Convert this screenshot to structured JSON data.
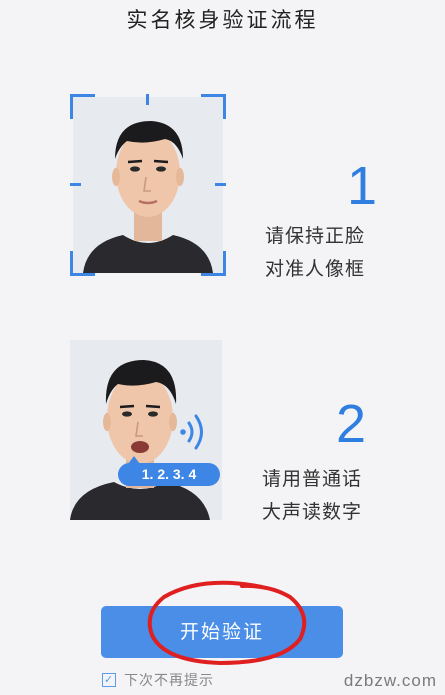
{
  "header": {
    "title": "实名核身验证流程"
  },
  "steps": [
    {
      "number": "1",
      "line1": "请保持正脸",
      "line2": "对准人像框"
    },
    {
      "number": "2",
      "line1": "请用普通话",
      "line2": "大声读数字",
      "digits": "1. 2. 3. 4"
    }
  ],
  "actions": {
    "start_label": "开始验证",
    "dont_show_label": "下次不再提示",
    "dont_show_checked": true
  },
  "watermark": "dzbzw.com",
  "colors": {
    "accent": "#3d86e6",
    "button": "#4a8ee8",
    "annotation": "#e02020"
  }
}
